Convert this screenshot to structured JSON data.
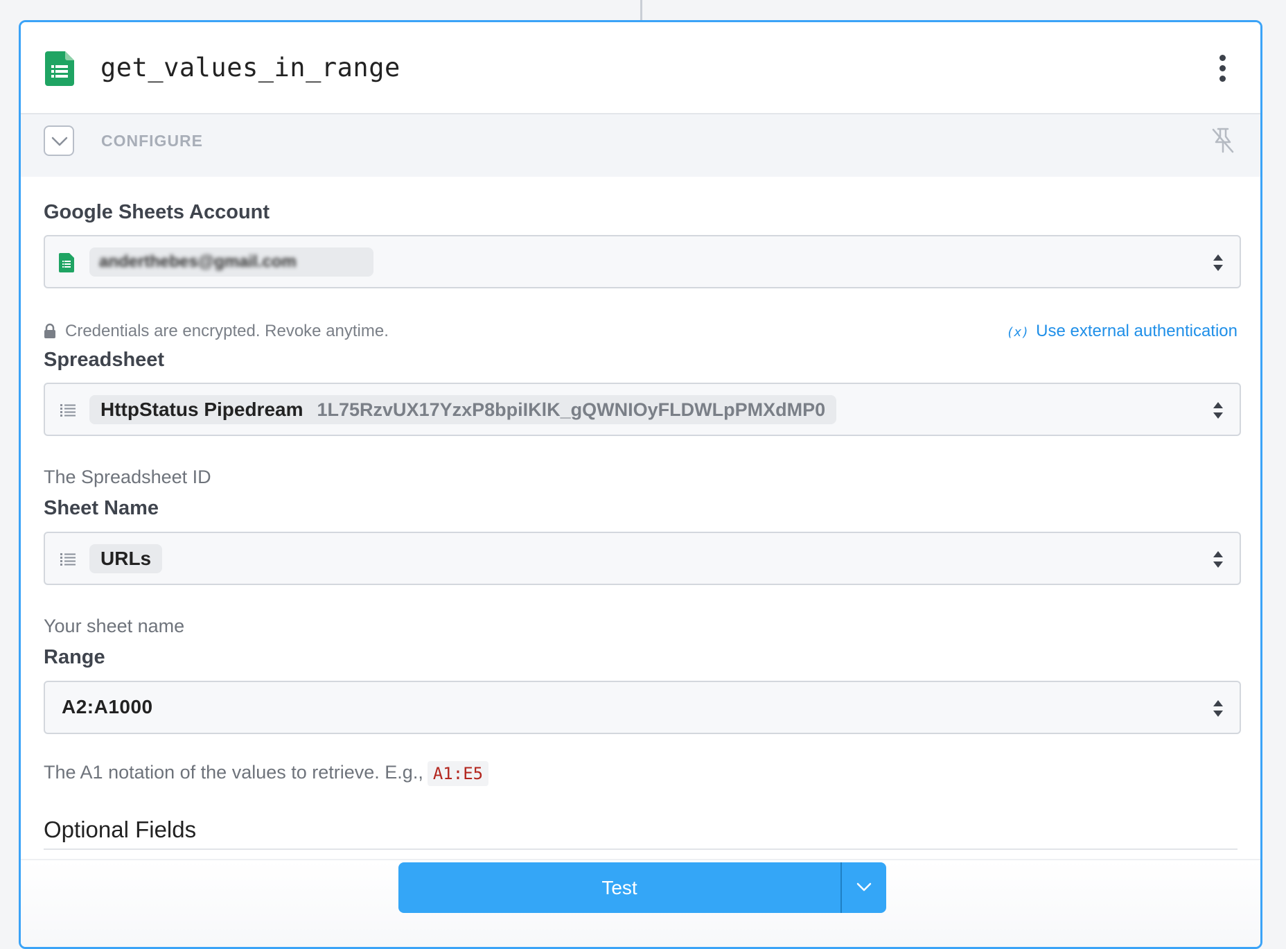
{
  "step": {
    "title": "get_values_in_range",
    "logo_icon": "google-sheets-icon",
    "menu_icon": "kebab-menu-icon"
  },
  "configure": {
    "label": "CONFIGURE",
    "collapse_icon": "chevron-down-icon",
    "pin_icon": "unpin-icon"
  },
  "account": {
    "label": "Google Sheets Account",
    "value": "anderthebes@gmail.com",
    "credentials_note": "Credentials are encrypted. Revoke anytime.",
    "external_auth_icon": "(x)",
    "external_auth_label": "Use external authentication"
  },
  "spreadsheet": {
    "label": "Spreadsheet",
    "value_name": "HttpStatus Pipedream",
    "value_id": "1L75RzvUX17YzxP8bpiIKlK_gQWNIOyFLDWLpPMXdMP0",
    "hint": "The Spreadsheet ID"
  },
  "sheet_name": {
    "label": "Sheet Name",
    "value": "URLs",
    "hint": "Your sheet name"
  },
  "range": {
    "label": "Range",
    "value": "A2:A1000",
    "hint": "The A1 notation of the values to retrieve. E.g.,",
    "example": "A1:E5"
  },
  "optional": {
    "title": "Optional Fields"
  },
  "footer": {
    "test_label": "Test",
    "dropdown_icon": "chevron-down-icon"
  },
  "colors": {
    "accent": "#34a6f7",
    "border_active": "#3ba3f7",
    "sheets_green": "#1fa463",
    "link": "#1f8fe8"
  }
}
